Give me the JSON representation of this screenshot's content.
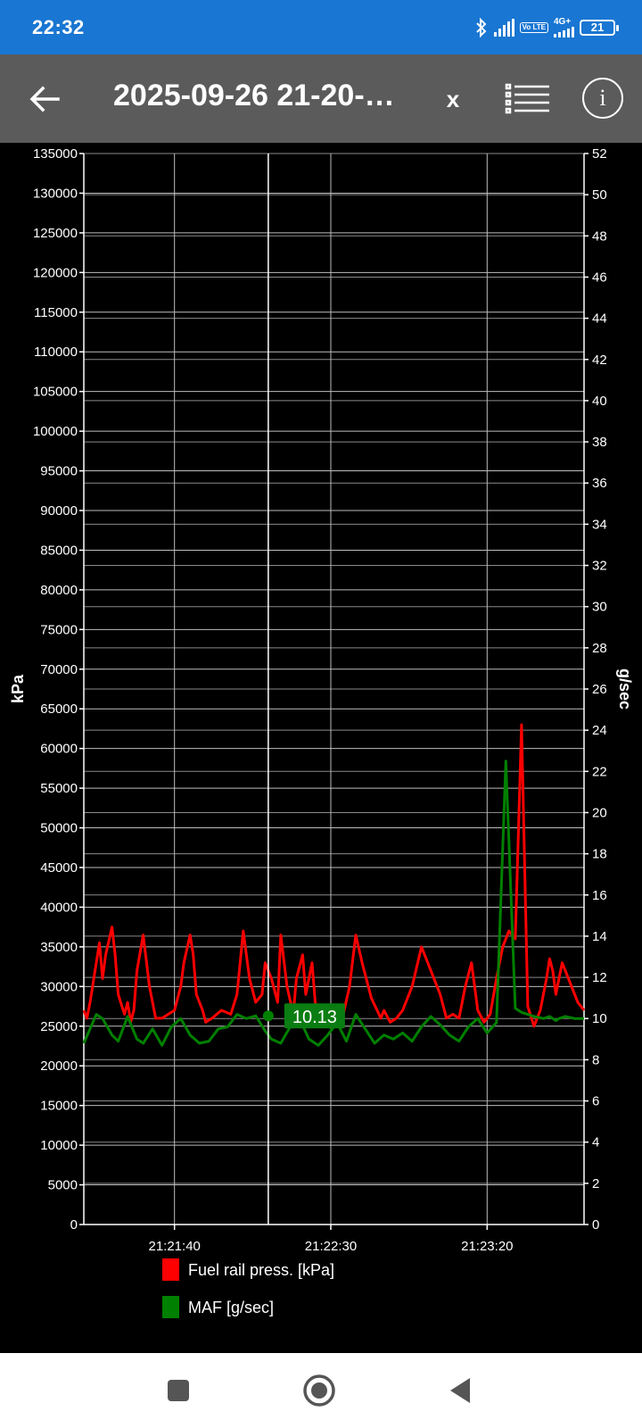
{
  "status_bar": {
    "time": "22:32",
    "icons": [
      "bluetooth-icon",
      "signal-icon",
      "volte-icon",
      "4g-signal-icon",
      "battery-icon"
    ],
    "volte_label": "Vo LTE",
    "network_label": "4G+",
    "battery_level": "21"
  },
  "app_bar": {
    "back_icon": "arrow-left-icon",
    "title": "2025-09-26 21-20-…",
    "close_label": "x",
    "list_icon": "list-icon",
    "info_label": "i"
  },
  "chart_data": {
    "type": "line",
    "left_axis": {
      "label": "kPa",
      "min": 0,
      "max": 135000,
      "ticks": [
        "0",
        "5000",
        "10000",
        "15000",
        "20000",
        "25000",
        "30000",
        "35000",
        "40000",
        "45000",
        "50000",
        "55000",
        "60000",
        "65000",
        "70000",
        "75000",
        "80000",
        "85000",
        "90000",
        "95000",
        "100000",
        "105000",
        "110000",
        "115000",
        "120000",
        "125000",
        "130000",
        "135000"
      ]
    },
    "right_axis": {
      "label": "g/sec",
      "min": 0,
      "max": 52,
      "ticks": [
        "0",
        "2",
        "4",
        "6",
        "8",
        "10",
        "12",
        "14",
        "16",
        "18",
        "20",
        "22",
        "24",
        "26",
        "28",
        "30",
        "32",
        "34",
        "36",
        "38",
        "40",
        "42",
        "44",
        "46",
        "48",
        "50",
        "52"
      ]
    },
    "x_axis": {
      "start": "21:21:11",
      "end": "21:23:51",
      "ticks": [
        "21:21:40",
        "21:22:30",
        "21:23:20"
      ]
    },
    "grid": true,
    "cursor": {
      "time": "21:22:10",
      "value_label": "10.13"
    },
    "legend": [
      {
        "name": "Fuel rail press. [kPa]",
        "color": "#ff0000"
      },
      {
        "name": "MAF [g/sec]",
        "color": "#008000"
      }
    ],
    "series": [
      {
        "name": "Fuel rail press. [kPa]",
        "axis": "left",
        "color": "#ff0000",
        "x": [
          "21:21:11",
          "21:21:12",
          "21:21:13",
          "21:21:15",
          "21:21:16",
          "21:21:17",
          "21:21:18",
          "21:21:20",
          "21:21:21",
          "21:21:22",
          "21:21:24",
          "21:21:25",
          "21:21:26",
          "21:21:27",
          "21:21:28",
          "21:21:30",
          "21:21:32",
          "21:21:34",
          "21:21:36",
          "21:21:38",
          "21:21:40",
          "21:21:42",
          "21:21:43",
          "21:21:45",
          "21:21:46",
          "21:21:47",
          "21:21:49",
          "21:21:50",
          "21:21:52",
          "21:21:55",
          "21:21:58",
          "21:22:00",
          "21:22:02",
          "21:22:04",
          "21:22:06",
          "21:22:08",
          "21:22:09",
          "21:22:11",
          "21:22:13",
          "21:22:14",
          "21:22:16",
          "21:22:18",
          "21:22:19",
          "21:22:21",
          "21:22:22",
          "21:22:24",
          "21:22:25",
          "21:22:27",
          "21:22:28",
          "21:22:30",
          "21:22:32",
          "21:22:34",
          "21:22:36",
          "21:22:38",
          "21:22:40",
          "21:22:43",
          "21:22:46",
          "21:22:47",
          "21:22:49",
          "21:22:51",
          "21:22:53",
          "21:22:56",
          "21:22:59",
          "21:23:02",
          "21:23:05",
          "21:23:07",
          "21:23:09",
          "21:23:11",
          "21:23:13",
          "21:23:15",
          "21:23:17",
          "21:23:19",
          "21:23:21",
          "21:23:23",
          "21:23:25",
          "21:23:27",
          "21:23:29",
          "21:23:31",
          "21:23:33",
          "21:23:35",
          "21:23:37",
          "21:23:39",
          "21:23:40",
          "21:23:41",
          "21:23:42",
          "21:23:43",
          "21:23:44",
          "21:23:45",
          "21:23:47",
          "21:23:49",
          "21:23:51"
        ],
        "values": [
          27000,
          26000,
          28000,
          33000,
          35500,
          31000,
          34000,
          37500,
          34000,
          29000,
          26500,
          28000,
          25500,
          27000,
          32000,
          36500,
          30000,
          26000,
          26000,
          26500,
          27000,
          30000,
          33000,
          36500,
          34000,
          29000,
          27000,
          25500,
          26000,
          27000,
          26500,
          29000,
          37000,
          31000,
          28000,
          29000,
          33000,
          31000,
          28000,
          36500,
          30000,
          26500,
          31000,
          34000,
          29000,
          33000,
          28000,
          26000,
          25500,
          26000,
          25500,
          26500,
          30000,
          36500,
          33000,
          28500,
          26000,
          27000,
          25500,
          26000,
          27000,
          30000,
          35000,
          32000,
          29000,
          26000,
          26500,
          26000,
          30000,
          33000,
          27000,
          25500,
          26500,
          31000,
          35000,
          37000,
          36000,
          63000,
          27500,
          25000,
          27000,
          31000,
          33500,
          32000,
          29000,
          31000,
          33000,
          32000,
          30000,
          28000,
          27000
        ]
      },
      {
        "name": "MAF [g/sec]",
        "axis": "right",
        "color": "#008000",
        "x": [
          "21:21:11",
          "21:21:13",
          "21:21:15",
          "21:21:17",
          "21:21:20",
          "21:21:22",
          "21:21:25",
          "21:21:28",
          "21:21:30",
          "21:21:33",
          "21:21:36",
          "21:21:39",
          "21:21:42",
          "21:21:45",
          "21:21:48",
          "21:21:51",
          "21:21:54",
          "21:21:57",
          "21:22:00",
          "21:22:03",
          "21:22:06",
          "21:22:09",
          "21:22:11",
          "21:22:14",
          "21:22:17",
          "21:22:20",
          "21:22:23",
          "21:22:26",
          "21:22:29",
          "21:22:32",
          "21:22:35",
          "21:22:38",
          "21:22:41",
          "21:22:44",
          "21:22:47",
          "21:22:50",
          "21:22:53",
          "21:22:56",
          "21:22:59",
          "21:23:02",
          "21:23:05",
          "21:23:08",
          "21:23:11",
          "21:23:14",
          "21:23:17",
          "21:23:20",
          "21:23:23",
          "21:23:26",
          "21:23:29",
          "21:23:31",
          "21:23:33",
          "21:23:35",
          "21:23:38",
          "21:23:40",
          "21:23:41",
          "21:23:42",
          "21:23:43",
          "21:23:45",
          "21:23:48",
          "21:23:51"
        ],
        "values": [
          8.8,
          9.5,
          10.2,
          10.0,
          9.2,
          8.9,
          10.1,
          9.0,
          8.8,
          9.5,
          8.7,
          9.6,
          10.0,
          9.2,
          8.8,
          8.9,
          9.5,
          9.6,
          10.2,
          10.0,
          10.13,
          9.4,
          9.0,
          8.8,
          9.6,
          10.0,
          9.0,
          8.7,
          9.2,
          9.8,
          8.9,
          10.2,
          9.5,
          8.8,
          9.2,
          9.0,
          9.3,
          8.9,
          9.6,
          10.1,
          9.7,
          9.2,
          8.9,
          9.6,
          10.0,
          9.3,
          9.8,
          22.5,
          10.5,
          10.3,
          10.2,
          10.1,
          10.0,
          10.1,
          10.0,
          9.9,
          10.0,
          10.1,
          10.0,
          10.0
        ]
      }
    ]
  },
  "nav_bar": {
    "buttons": [
      "recents-icon",
      "home-icon",
      "back-triangle-icon"
    ]
  }
}
